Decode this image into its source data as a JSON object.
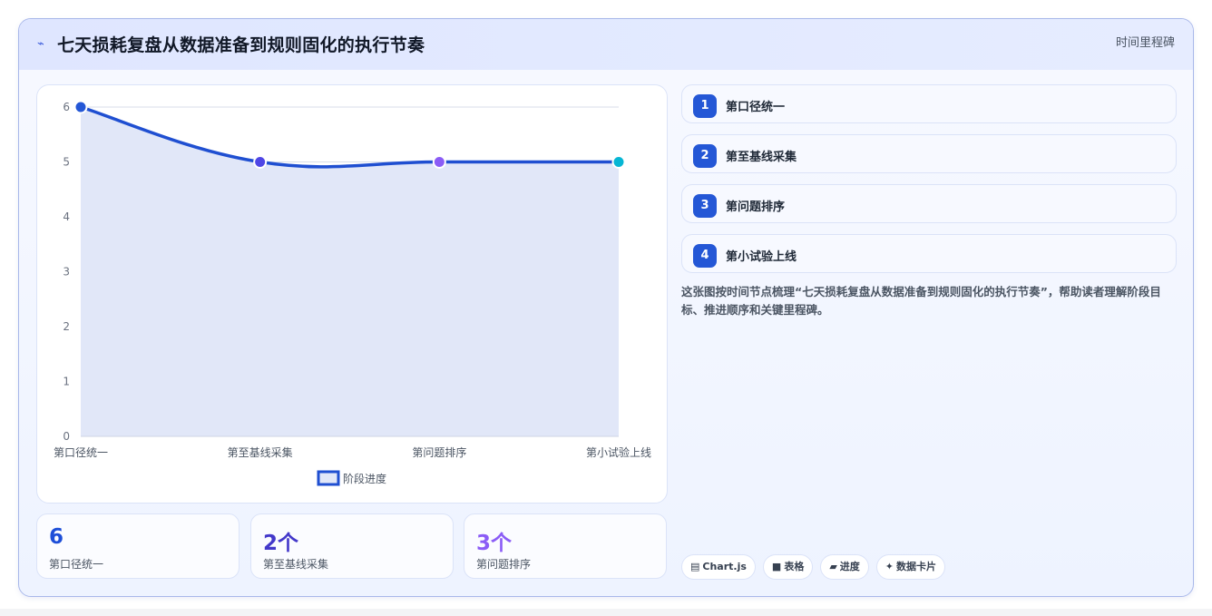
{
  "header": {
    "icon": "trend-icon",
    "title": "七天损耗复盘从数据准备到规则固化的执行节奏",
    "tag": "时间里程碑"
  },
  "chart_data": {
    "type": "line",
    "categories": [
      "第口径统一",
      "第至基线采集",
      "第问题排序",
      "第小试验上线"
    ],
    "series": [
      {
        "name": "阶段进度",
        "values": [
          6,
          5,
          5,
          5
        ]
      }
    ],
    "ylim": [
      0,
      6
    ],
    "yticks": [
      0,
      1,
      2,
      3,
      4,
      5,
      6
    ],
    "grid": true,
    "legend": "bottom",
    "line_color": "#1f4fd1",
    "fill_color": "#e1e7f8",
    "point_colors": [
      "#2457d6",
      "#4f46e5",
      "#8b5cf6",
      "#06b6d4"
    ]
  },
  "stats": [
    {
      "value": "6",
      "label": "第口径统一",
      "color": "#1d4ed8"
    },
    {
      "value": "2个",
      "label": "第至基线采集",
      "color": "#4338ca"
    },
    {
      "value": "3个",
      "label": "第问题排序",
      "color": "#8b5cf6"
    }
  ],
  "steps": [
    {
      "num": "1",
      "label": "第口径统一"
    },
    {
      "num": "2",
      "label": "第至基线采集"
    },
    {
      "num": "3",
      "label": "第问题排序"
    },
    {
      "num": "4",
      "label": "第小试验上线"
    }
  ],
  "description": "这张图按时间节点梳理“七天损耗复盘从数据准备到规则固化的执行节奏”，帮助读者理解阶段目标、推进顺序和关键里程碑。",
  "chips": [
    {
      "icon": "chart-icon",
      "glyph": "▤",
      "label": "Chart.js"
    },
    {
      "icon": "table-icon",
      "glyph": "■",
      "label": "表格"
    },
    {
      "icon": "progress-icon",
      "glyph": "▰",
      "label": "进度"
    },
    {
      "icon": "card-icon",
      "glyph": "✦",
      "label": "数据卡片"
    }
  ]
}
